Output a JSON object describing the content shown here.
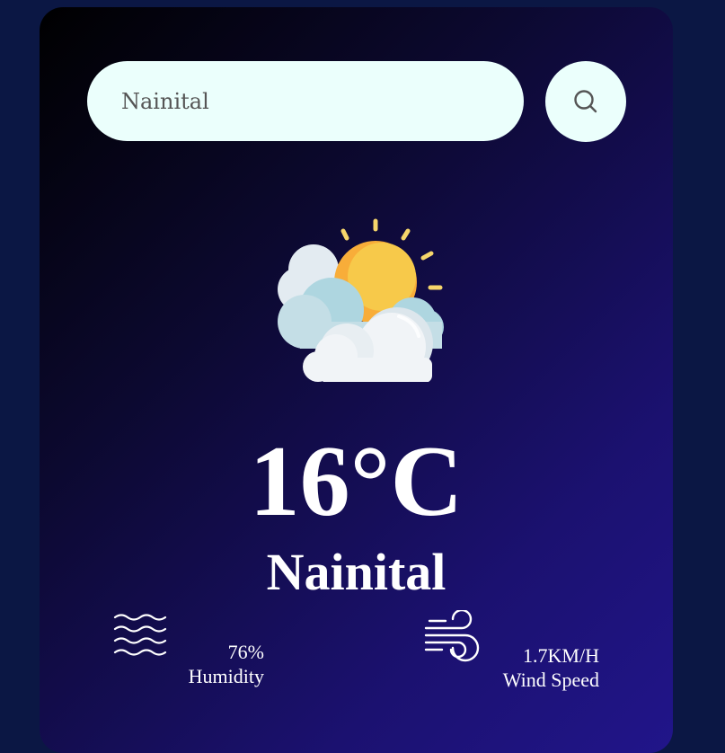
{
  "search": {
    "value": "Nainital",
    "button_icon": "search-icon"
  },
  "weather": {
    "icon": "sun-behind-clouds-icon",
    "temperature": "16°C",
    "city": "Nainital"
  },
  "humidity": {
    "icon": "waves-icon",
    "value": "76%",
    "label": "Humidity"
  },
  "wind": {
    "icon": "wind-icon",
    "value": "1.7KM/H",
    "label": "Wind Speed"
  },
  "colors": {
    "page_background": "#0b1744",
    "card_gradient_start": "#000000",
    "card_gradient_end": "#21158a",
    "search_background": "#ebfffc",
    "text": "#ffffff"
  }
}
